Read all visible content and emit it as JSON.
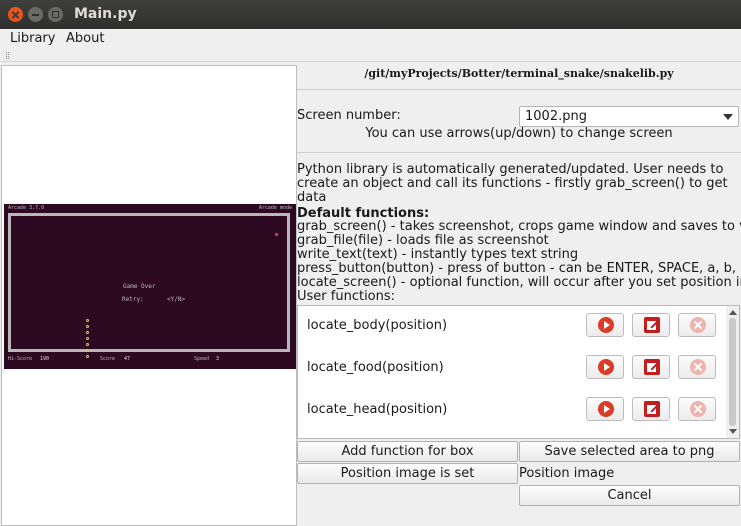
{
  "window": {
    "title": "Main.py"
  },
  "menu": {
    "library": "Library",
    "about": "About"
  },
  "preview": {
    "game": {
      "top_left": "Arcade 3.7.0",
      "top_right": "Arcade mode",
      "game_over": "Game Over",
      "retry": "Retry:",
      "retry_options": "<Y/N>",
      "hiscore_label": "Hi-Score",
      "hiscore_value": "190",
      "score_label": "Score",
      "score_value": "47",
      "speed_label": "Speed",
      "speed_value": "3"
    }
  },
  "path": "/git/myProjects/Botter/terminal_snake/snakelib.py",
  "screen": {
    "label": "Screen number:",
    "selected": "1002.png",
    "hint": "You can use arrows(up/down) to change screen"
  },
  "description": "Python library is automatically generated/updated. User needs to create an object and call its functions - firstly grab_screen() to get data",
  "default_functions": {
    "heading": "Default functions:",
    "lines": [
      "grab_screen() - takes screenshot, crops game window and saves to var",
      "grab_file(file) - loads file as screenshot",
      "write_text(text) - instantly types text string",
      "press_button(button) - press of button - can be ENTER, SPACE, a, b, ....",
      "locate_screen() - optional function, will occur after you set position image"
    ]
  },
  "user_functions": {
    "heading": "User functions:",
    "items": [
      {
        "name": "locate_body(position)"
      },
      {
        "name": "locate_food(position)"
      },
      {
        "name": "locate_head(position)"
      }
    ]
  },
  "buttons": {
    "add_function": "Add function for box",
    "save_area": "Save selected area to png",
    "position_set": "Position image is set",
    "position_label": "Position image",
    "cancel": "Cancel"
  },
  "colors": {
    "game_bg": "#2e0a22",
    "close_button": "#e9541e",
    "run_icon": "#dc3b26",
    "edit_icon": "#c41d1d",
    "delete_icon": "#efb3ad"
  }
}
